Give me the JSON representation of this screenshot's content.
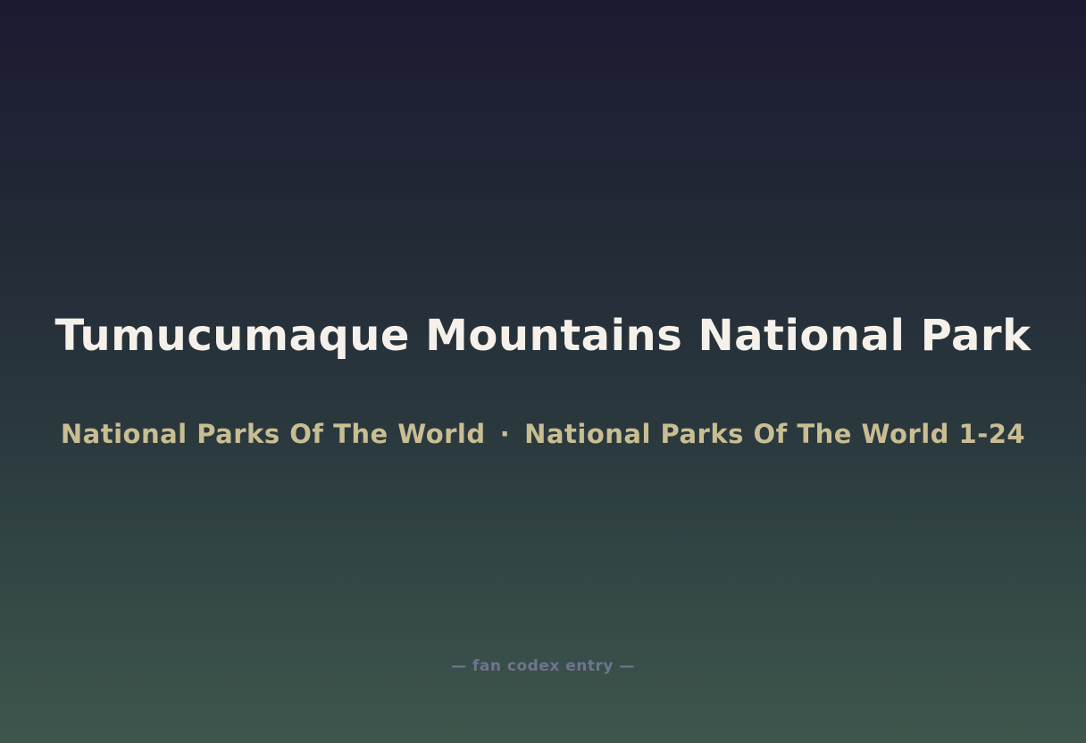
{
  "title": "Tumucumaque Mountains National Park",
  "subtitle": {
    "series": "National Parks Of The World",
    "separator": "·",
    "set": "National Parks Of The World 1-24"
  },
  "footer": "— fan codex entry —"
}
